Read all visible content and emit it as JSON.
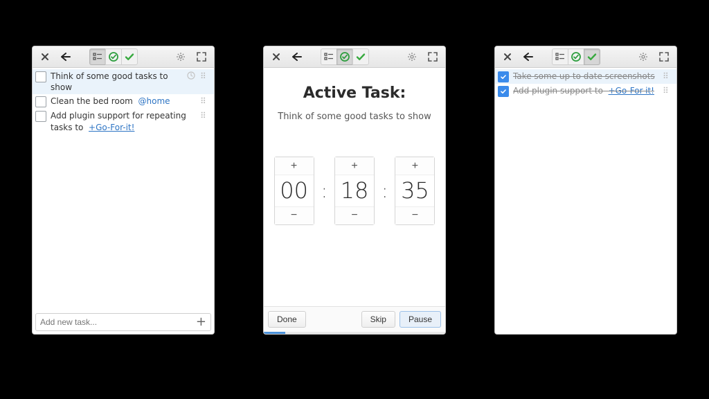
{
  "windows": {
    "todo": {
      "tasks": [
        {
          "text": "Think of some good tasks to show",
          "done": false,
          "selected": true,
          "hasClock": true
        },
        {
          "text": "Clean the bed room",
          "context": "@home",
          "done": false
        },
        {
          "text": "Add plugin support for repeating tasks to",
          "linkText": "+Go-For-it!",
          "done": false
        }
      ],
      "addPlaceholder": "Add new task..."
    },
    "active": {
      "title": "Active Task:",
      "taskText": "Think of some good tasks to show",
      "timer": {
        "hh": "00",
        "mm": "18",
        "ss": "35"
      },
      "buttons": {
        "done": "Done",
        "skip": "Skip",
        "pause": "Pause"
      },
      "progressPercent": 12
    },
    "done": {
      "tasks": [
        {
          "text": "Take some up to date screenshots",
          "done": true,
          "selected": true
        },
        {
          "text": "Add plugin support to",
          "linkText": "+Go-For-it!",
          "done": true
        }
      ]
    }
  },
  "toolbar": [
    "close",
    "back",
    "list",
    "active",
    "done",
    "settings",
    "fullscreen"
  ],
  "glyphs": {
    "plus": "+",
    "minus": "−",
    "colon": ":"
  }
}
